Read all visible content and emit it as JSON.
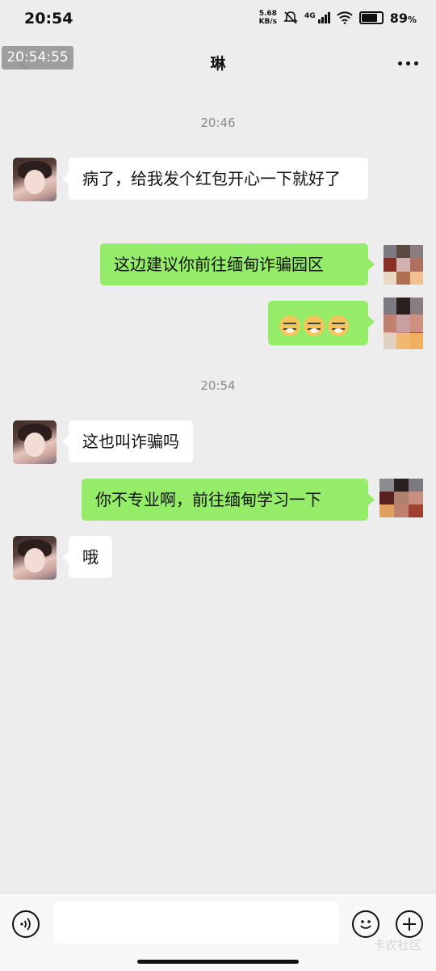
{
  "status_bar": {
    "time": "20:54",
    "net_speed_value": "5.68",
    "net_speed_unit": "KB/s",
    "signal_label": "4G",
    "battery": "89",
    "battery_unit": "%",
    "battery_level": 0.89
  },
  "overlay": {
    "timestamp": "20:54:55"
  },
  "header": {
    "title": "琳"
  },
  "messages": [
    {
      "type": "time",
      "text": "20:46"
    },
    {
      "type": "text",
      "from": "other",
      "text": "病了，给我发个红包开心一下就好了"
    },
    {
      "type": "text",
      "from": "me",
      "text": "这边建议你前往缅甸诈骗园区"
    },
    {
      "type": "emoji",
      "from": "me",
      "emoji": [
        "doge-icon",
        "doge-icon",
        "doge-icon"
      ]
    },
    {
      "type": "time",
      "text": "20:54"
    },
    {
      "type": "text",
      "from": "other",
      "text": "这也叫诈骗吗"
    },
    {
      "type": "text",
      "from": "me",
      "text": "你不专业啊，前往缅甸学习一下"
    },
    {
      "type": "text",
      "from": "other",
      "text": "哦"
    }
  ],
  "input_bar": {
    "placeholder": ""
  },
  "watermark": "卡农社区",
  "colors": {
    "bubble_out": "#95ec69",
    "bubble_in": "#ffffff",
    "background": "#ededed"
  }
}
